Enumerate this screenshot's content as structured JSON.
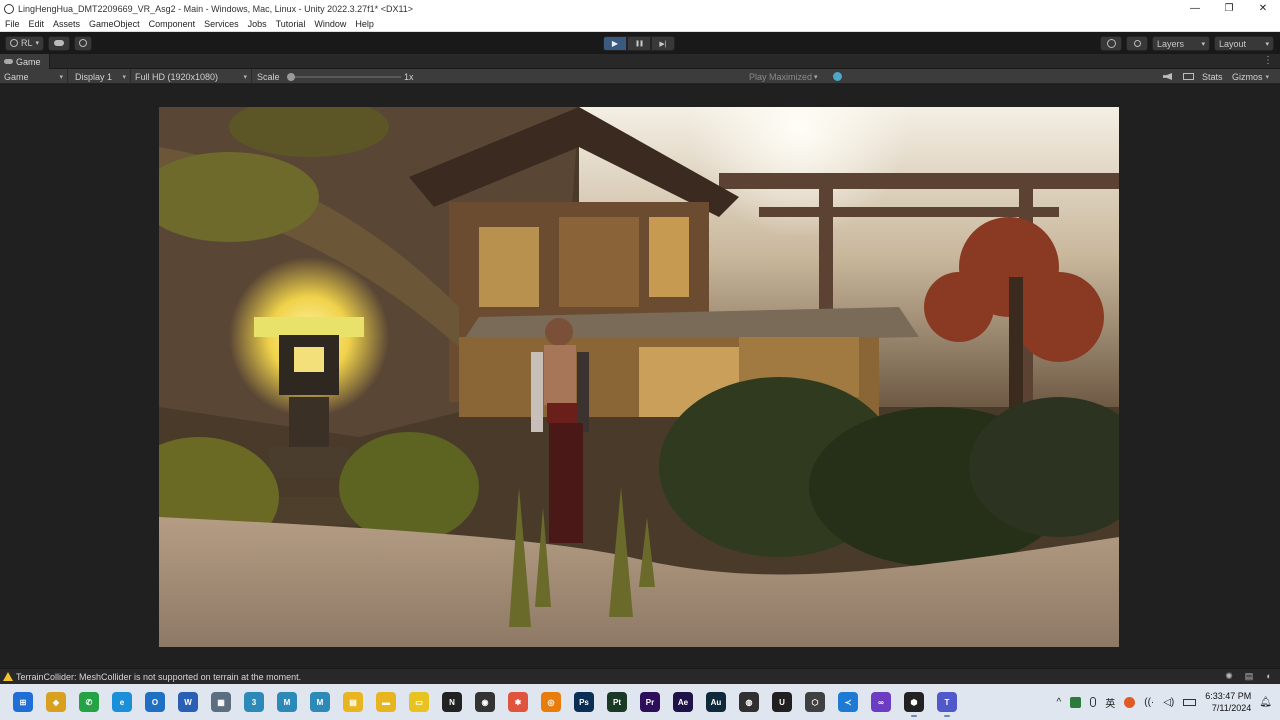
{
  "window": {
    "title": "LingHengHua_DMT2209669_VR_Asg2 - Main - Windows, Mac, Linux - Unity 2022.3.27f1* <DX11>",
    "controls": [
      "—",
      "❐",
      "✕"
    ]
  },
  "menu": [
    "File",
    "Edit",
    "Assets",
    "GameObject",
    "Component",
    "Services",
    "Jobs",
    "Tutorial",
    "Window",
    "Help"
  ],
  "toolbar": {
    "account_label": "RL",
    "account_caret": "▾",
    "play_icons": [
      "▶",
      "❚❚",
      "▶|"
    ],
    "layers_label": "Layers",
    "layout_label": "Layout",
    "caret": "▾"
  },
  "game_tab": {
    "label": "Game",
    "menu_glyph": "⋮"
  },
  "game_bar": {
    "view_mode": "Game",
    "display": "Display 1",
    "resolution": "Full HD (1920x1080)",
    "scale_label": "Scale",
    "scale_value": "1x",
    "play_mode": "Play Maximized",
    "stats": "Stats",
    "gizmos": "Gizmos",
    "caret": "▾"
  },
  "status": {
    "message": "TerrainCollider: MeshCollider is not supported on terrain at the moment."
  },
  "taskbar": {
    "apps": [
      {
        "name": "start-icon",
        "glyph": "⊞",
        "color": "#1f6fd6"
      },
      {
        "name": "layers-app-icon",
        "glyph": "◆",
        "color": "#d9a020"
      },
      {
        "name": "whatsapp-icon",
        "glyph": "✆",
        "color": "#25a244"
      },
      {
        "name": "edge-icon",
        "glyph": "e",
        "color": "#1b8fd8"
      },
      {
        "name": "outlook-icon",
        "glyph": "O",
        "color": "#1f6fc2"
      },
      {
        "name": "word-icon",
        "glyph": "W",
        "color": "#2b5fb4"
      },
      {
        "name": "image-app-icon",
        "glyph": "▦",
        "color": "#5c6e80"
      },
      {
        "name": "app-3-icon",
        "glyph": "3",
        "color": "#2d8ab8"
      },
      {
        "name": "app-m1-icon",
        "glyph": "M",
        "color": "#2d8ab8"
      },
      {
        "name": "app-m2-icon",
        "glyph": "M",
        "color": "#2d8ab8"
      },
      {
        "name": "notes-icon",
        "glyph": "▤",
        "color": "#e8b41f"
      },
      {
        "name": "folder-icon",
        "glyph": "▬",
        "color": "#e8b41f"
      },
      {
        "name": "sticky-icon",
        "glyph": "▭",
        "color": "#e8c21f"
      },
      {
        "name": "notion-icon",
        "glyph": "N",
        "color": "#222222"
      },
      {
        "name": "github-icon",
        "glyph": "◉",
        "color": "#333333"
      },
      {
        "name": "figma-icon",
        "glyph": "✱",
        "color": "#e0533c"
      },
      {
        "name": "blender-icon",
        "glyph": "◎",
        "color": "#e87d0d"
      },
      {
        "name": "photoshop-icon",
        "glyph": "Ps",
        "color": "#0b2e55"
      },
      {
        "name": "painter-icon",
        "glyph": "Pt",
        "color": "#1a3a26"
      },
      {
        "name": "premiere-icon",
        "glyph": "Pr",
        "color": "#2e0e5a"
      },
      {
        "name": "after-effects-icon",
        "glyph": "Ae",
        "color": "#1e1248"
      },
      {
        "name": "audition-icon",
        "glyph": "Au",
        "color": "#0e2a3a"
      },
      {
        "name": "obs-icon",
        "glyph": "◍",
        "color": "#303030"
      },
      {
        "name": "unreal-icon",
        "glyph": "U",
        "color": "#202020"
      },
      {
        "name": "unity-hub-icon",
        "glyph": "⬡",
        "color": "#404040"
      },
      {
        "name": "vscode-icon",
        "glyph": "≺",
        "color": "#1f7ad4"
      },
      {
        "name": "visual-studio-icon",
        "glyph": "∞",
        "color": "#6c3cc2"
      },
      {
        "name": "unity-icon",
        "glyph": "⬢",
        "color": "#222222"
      },
      {
        "name": "teams-icon",
        "glyph": "T",
        "color": "#5059c9"
      }
    ],
    "tray_chevron": "^",
    "ime": "英",
    "time": "6:33:47 PM",
    "date": "7/11/2024"
  }
}
